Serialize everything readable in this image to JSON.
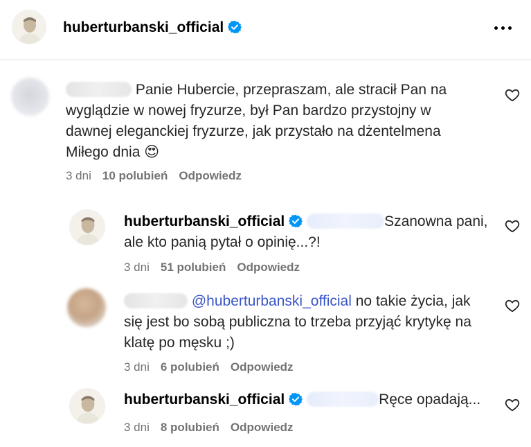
{
  "header": {
    "username": "huberturbanski_official",
    "verified_icon": "verified-badge-icon",
    "more_icon": "more-options-icon"
  },
  "comments": [
    {
      "text": "Panie Hubercie, przepraszam, ale stracił Pan na wyglądzie w nowej fryzurze, był Pan bardzo przystojny w dawnej eleganckiej fryzurze, jak przystało na dżentelmena Miłego dnia",
      "emoji": "😍",
      "time": "3 dni",
      "likes": "10 polubień",
      "reply": "Odpowiedz"
    },
    {
      "username": "huberturbanski_official",
      "text": "Szanowna pani, ale kto panią pytał o opinię...?!",
      "time": "3 dni",
      "likes": "51 polubień",
      "reply": "Odpowiedz"
    },
    {
      "mention": "@huberturbanski_official",
      "text": "no takie życia, jak się jest bo sobą publiczna to trzeba przyjąć krytykę na klatę po męsku ;)",
      "time": "3 dni",
      "likes": "6 polubień",
      "reply": "Odpowiedz"
    },
    {
      "username": "huberturbanski_official",
      "text": "Ręce opadają...",
      "time": "3 dni",
      "likes": "8 polubień",
      "reply": "Odpowiedz"
    }
  ],
  "colors": {
    "verified": "#0095f6",
    "mention": "#3a55c7",
    "meta": "#737373"
  }
}
